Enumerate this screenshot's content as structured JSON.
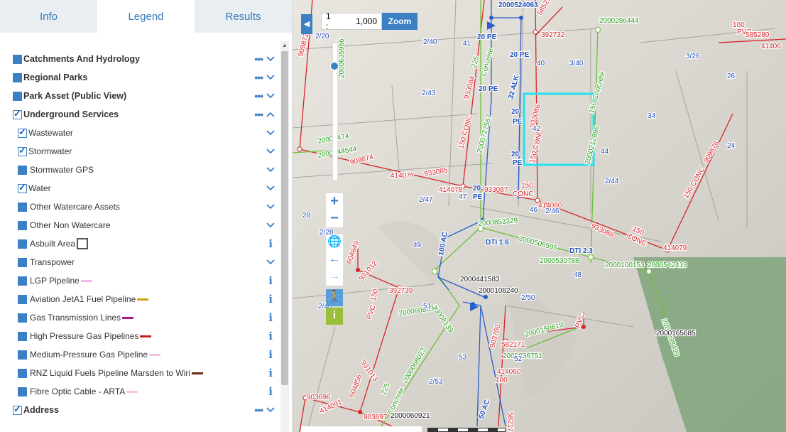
{
  "tabs": [
    {
      "label": "Info",
      "active": false
    },
    {
      "label": "Legend",
      "active": true
    },
    {
      "label": "Results",
      "active": false
    }
  ],
  "legend": [
    {
      "label": "Catchments And Hydrology",
      "type": "group",
      "checkbox": "filled",
      "actions": "dots-chevron-down"
    },
    {
      "label": "Regional Parks",
      "type": "group",
      "checkbox": "filled",
      "actions": "dots-chevron-down"
    },
    {
      "label": "Park Asset (Public View)",
      "type": "group",
      "checkbox": "filled",
      "actions": "dots-chevron-down"
    },
    {
      "label": "Underground Services",
      "type": "group",
      "checkbox": "checked",
      "actions": "dots-chevron-up"
    },
    {
      "label": "Wastewater",
      "type": "item",
      "checkbox": "checked",
      "actions": "chevron-down"
    },
    {
      "label": "Stormwater",
      "type": "item",
      "checkbox": "checked",
      "actions": "chevron-down"
    },
    {
      "label": "Stormwater GPS",
      "type": "item",
      "checkbox": "filled",
      "actions": "chevron-down"
    },
    {
      "label": "Water",
      "type": "item",
      "checkbox": "checked",
      "actions": "chevron-down"
    },
    {
      "label": "Other Watercare Assets",
      "type": "item",
      "checkbox": "filled",
      "actions": "chevron-down"
    },
    {
      "label": "Other Non Watercare",
      "type": "item",
      "checkbox": "filled",
      "actions": "chevron-down"
    },
    {
      "label": "Asbuilt Area",
      "type": "item",
      "checkbox": "filled",
      "actions": "info",
      "swatch": "box"
    },
    {
      "label": "Transpower",
      "type": "item",
      "checkbox": "filled",
      "actions": "chevron-down"
    },
    {
      "label": "LGP Pipeline",
      "type": "item",
      "checkbox": "filled",
      "actions": "info",
      "swatch": "#f0b8e8"
    },
    {
      "label": "Aviation JetA1 Fuel Pipeline",
      "type": "item",
      "checkbox": "filled",
      "actions": "info",
      "swatch": "#d4a017"
    },
    {
      "label": "Gas Transmission Lines",
      "type": "item",
      "checkbox": "filled",
      "actions": "info",
      "swatch": "#b0189a"
    },
    {
      "label": "High Pressure Gas Pipelines",
      "type": "item",
      "checkbox": "filled",
      "actions": "info",
      "swatch": "#c81e1e"
    },
    {
      "label": "Medium-Pressure Gas Pipeline",
      "type": "item",
      "checkbox": "filled",
      "actions": "info",
      "swatch": "#f4c2e6"
    },
    {
      "label": "RNZ Liquid Fuels Pipeline Marsden to Wiri",
      "type": "item",
      "checkbox": "filled",
      "actions": "info",
      "swatch": "#6b2a12"
    },
    {
      "label": "Fibre Optic Cable - ARTA",
      "type": "item",
      "checkbox": "filled",
      "actions": "info",
      "swatch": "#f6c6e2"
    },
    {
      "label": "Address",
      "type": "group",
      "checkbox": "checked",
      "actions": "dots-chevron-down"
    }
  ],
  "map": {
    "scale_prefix": "1 :",
    "scale_value": "1,000",
    "zoom_label": "Zoom",
    "labels": {
      "red": [
        "585279",
        "392732",
        "909872",
        "933084",
        "150 CONC",
        "933086",
        "150 CONC",
        "909874",
        "933085",
        "414077",
        "414078",
        "933087",
        "CONC",
        "150",
        "414080",
        "933088",
        "150",
        "CONC",
        "909876",
        "150 CONC",
        "414079",
        "100",
        "PVC",
        "585280",
        "41406",
        "604849",
        "931012",
        "392739",
        "150",
        "PVC",
        "931013",
        "604856",
        "903696",
        "414091",
        "903697",
        "903700",
        "582171",
        "414060",
        "100",
        "PVC",
        "582170",
        "20000830"
      ],
      "green": [
        "2000286444",
        "225",
        "Concrete",
        "2000727567",
        "2000212896",
        "150 Concrete",
        "20009474",
        "2000144544",
        "2000853329",
        "2000506595",
        "2000530788",
        "2000100153",
        "2000542413",
        "2000398499",
        "20008139",
        "2000608894",
        "2000068023",
        "225",
        "Concrete",
        "2000150619",
        "2000836751",
        "2000635966"
      ],
      "blue": [
        "2000524063",
        "20 PE",
        "20 PE",
        "32 ALK",
        "20 PE",
        "20",
        "PE",
        "20",
        "PE",
        "20",
        "PE",
        "DTI 1.6",
        "DTI 2.3",
        "100 AC",
        "50 AC"
      ],
      "lot": [
        "2/20",
        "2/40",
        "41",
        "40",
        "3/40",
        "3/26",
        "26",
        "2/43",
        "42",
        "34",
        "44",
        "24",
        "2/44",
        "2/47",
        "47",
        "46",
        "2/46",
        "28",
        "2/28",
        "49",
        "48",
        "51",
        "2/50",
        "2/40",
        "53",
        "52",
        "2/53"
      ],
      "black": [
        "2000441583",
        "2000108240",
        "2000165685",
        "2000060921"
      ]
    }
  }
}
